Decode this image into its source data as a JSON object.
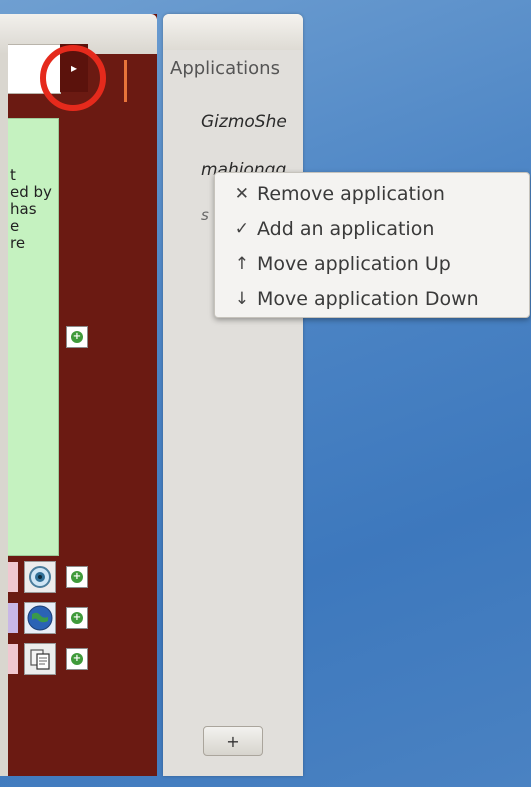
{
  "left_window": {
    "go_arrow": "▸",
    "note_lines": [
      "t",
      "ed by",
      "has",
      "e",
      "re"
    ]
  },
  "applications_panel": {
    "title": "Applications",
    "items": [
      {
        "label": "GizmoShe"
      },
      {
        "label": "mahjongg"
      },
      {
        "label": "s"
      }
    ],
    "add_button_label": "+"
  },
  "context_menu": {
    "items": [
      {
        "glyph": "✕",
        "label": "Remove application"
      },
      {
        "glyph": "✓",
        "label": "Add an application"
      },
      {
        "glyph": "↑",
        "label": "Move application Up"
      },
      {
        "glyph": "↓",
        "label": "Move application Down"
      }
    ]
  },
  "colors": {
    "desktop": "#4f87c6",
    "left_window_body": "#6b1a12",
    "highlight_ring": "#e52a1c",
    "note_panel": "#c5f2c0",
    "add_icon": "#3f9a3a"
  }
}
